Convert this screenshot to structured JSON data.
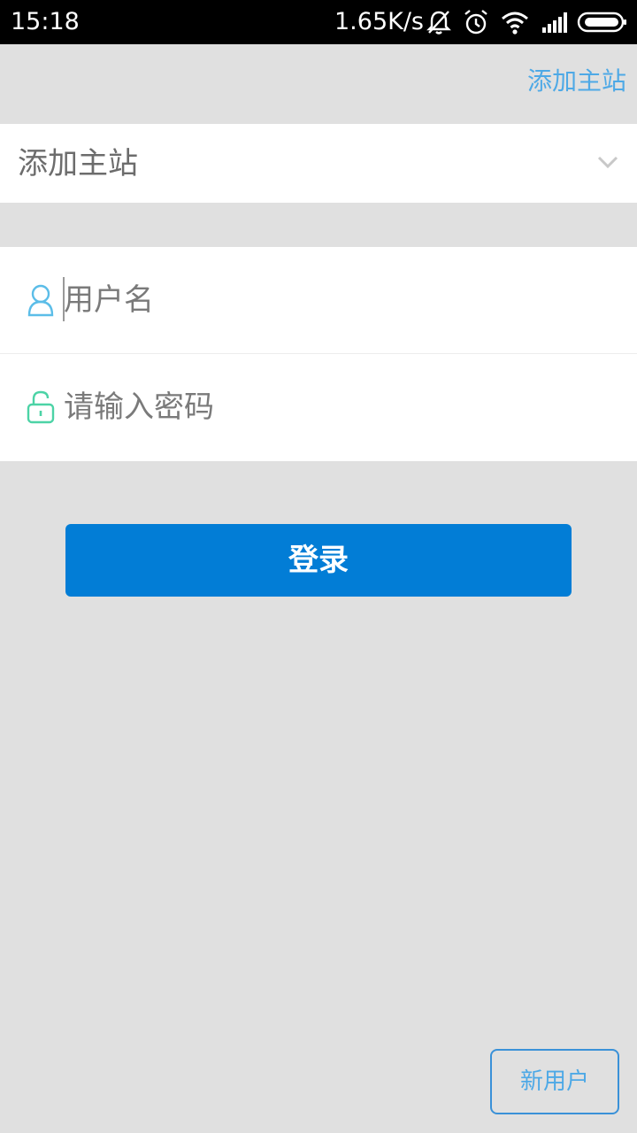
{
  "status_bar": {
    "time": "15:18",
    "network_speed": "1.65K/s",
    "icons": [
      "mute-vibrate-icon",
      "alarm-icon",
      "wifi-icon",
      "signal-icon",
      "battery-icon"
    ]
  },
  "header": {
    "add_site_link": "添加主站"
  },
  "site_selector": {
    "label": "添加主站",
    "icon": "chevron-down-icon"
  },
  "login_form": {
    "username_placeholder": "用户名",
    "username_value": "",
    "password_placeholder": "请输入密码",
    "password_value": "",
    "user_icon": "user-icon",
    "lock_icon": "lock-icon"
  },
  "actions": {
    "login_label": "登录",
    "new_user_label": "新用户"
  },
  "colors": {
    "primary": "#027dd6",
    "link": "#4ea9e6",
    "background": "#e0e0e0",
    "user_icon": "#5bbde8",
    "lock_icon": "#4cd3a6"
  }
}
